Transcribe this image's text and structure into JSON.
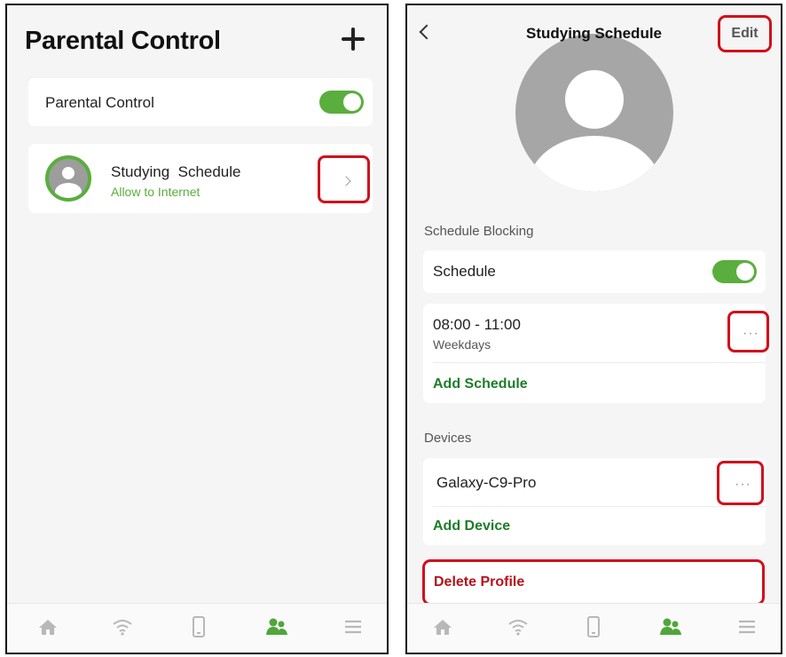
{
  "left": {
    "title": "Parental Control",
    "add_icon": "plus-icon",
    "toggle_row": {
      "label": "Parental Control",
      "enabled": true
    },
    "profile": {
      "name": "Studying  Schedule",
      "status": "Allow to Internet",
      "avatar_icon": "user-avatar-icon",
      "chevron_icon": "chevron-right-icon"
    }
  },
  "right": {
    "title": "Studying Schedule",
    "back_icon": "chevron-left-icon",
    "edit_label": "Edit",
    "schedule_section": {
      "header": "Schedule Blocking",
      "toggle_label": "Schedule",
      "enabled": true,
      "entry": {
        "time": "08:00 - 11:00",
        "days": "Weekdays",
        "more_label": "···"
      },
      "add_label": "Add Schedule"
    },
    "devices_section": {
      "header": "Devices",
      "device": {
        "name": "Galaxy-C9-Pro",
        "more_label": "···"
      },
      "add_label": "Add Device"
    },
    "delete_label": "Delete Profile"
  },
  "bottom_nav": {
    "items": [
      "home-icon",
      "wifi-icon",
      "device-icon",
      "family-icon",
      "menu-icon"
    ],
    "active": "family-icon"
  },
  "colors": {
    "accent_green": "#5aae3d",
    "link_green": "#1e7d2a",
    "highlight_red": "#d0101b",
    "danger_red": "#b5121b",
    "icon_gray": "#b8b8b8"
  }
}
